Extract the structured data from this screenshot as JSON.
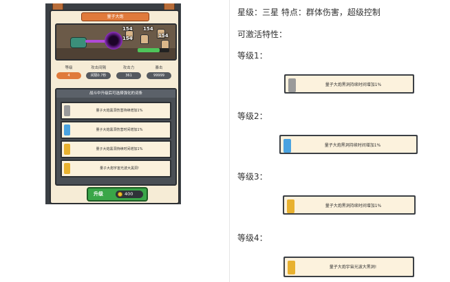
{
  "game": {
    "title": "量子大炮",
    "damage_numbers": [
      "154",
      "154",
      "154",
      "154"
    ],
    "stats": [
      {
        "label": "等级",
        "value": "4"
      },
      {
        "label": "攻击间隔",
        "value": "间隔0.7秒"
      },
      {
        "label": "攻击力",
        "value": "361"
      },
      {
        "label": "暴击",
        "value": "99999"
      }
    ],
    "traits_header": "战斗中升级后可选择强化的词条",
    "traits": [
      {
        "text": "量子大炮黑洞伤害持续增加1%",
        "color": "#9a9a9a"
      },
      {
        "text": "量子大炮黑洞伤害时间增加1%",
        "color": "#4aa3e0"
      },
      {
        "text": "量子大炮黑洞持续时间增加1%",
        "color": "#e8b130"
      },
      {
        "text": "量子大炮宇宙光波大黑洞!",
        "color": "#e8b130"
      }
    ],
    "upgrade_label": "升级",
    "upgrade_cost": "400"
  },
  "description": {
    "line1": "星级：三星     特点：群体伤害，超级控制",
    "line2": "可激活特性：",
    "levels": [
      {
        "label": "等级1：",
        "card_text": "量子大炮黑洞持续时间增加1%",
        "color": "#9a9a9a"
      },
      {
        "label": "等级2：",
        "card_text": "量子大炮黑洞持续时间增加1%",
        "color": "#4aa3e0"
      },
      {
        "label": "等级3：",
        "card_text": "量子大炮黑洞持续时间增加1%",
        "color": "#e8b130"
      },
      {
        "label": "等级4：",
        "card_text": "量子大炮宇宙光波大黑洞!",
        "color": "#e8b130"
      }
    ]
  }
}
